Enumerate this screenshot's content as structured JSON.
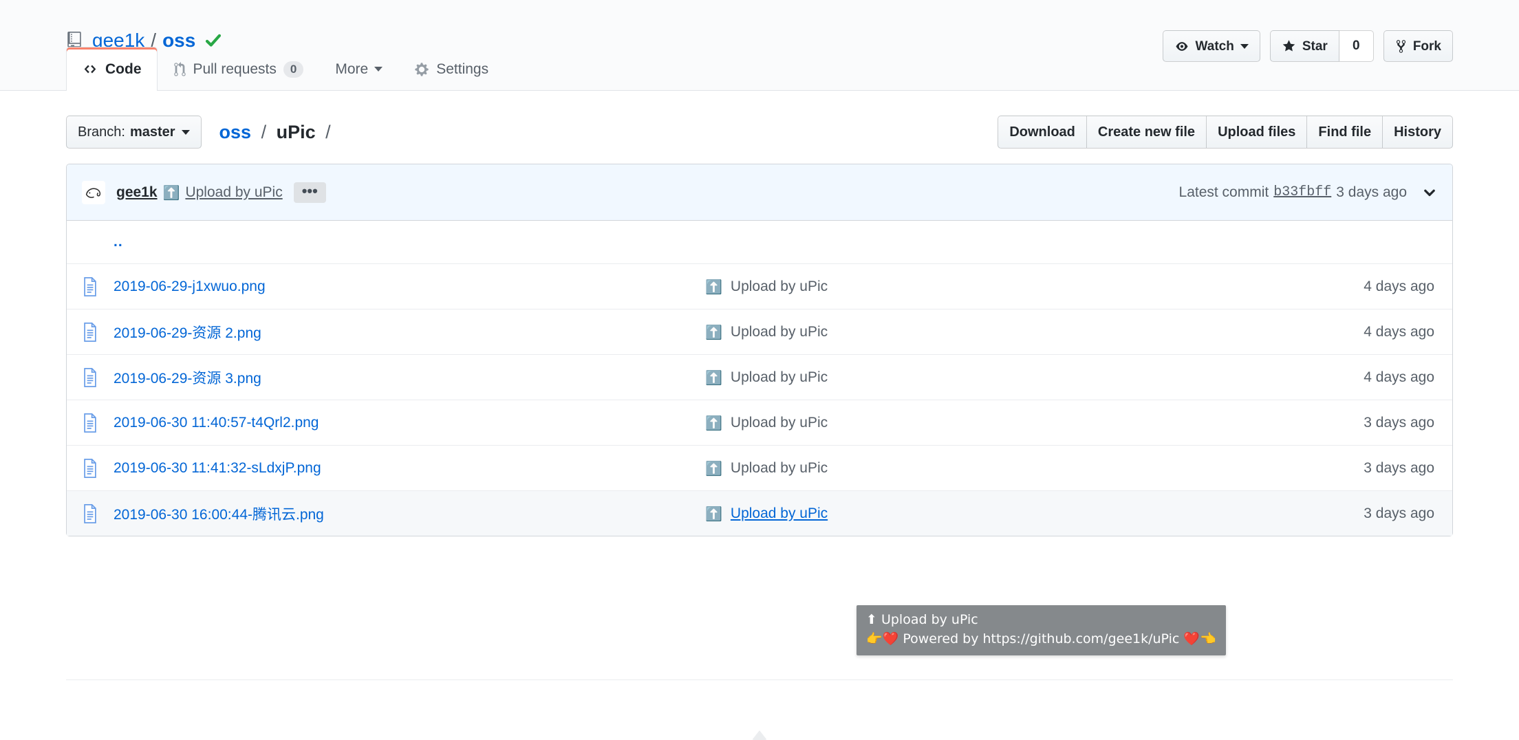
{
  "repo": {
    "icon": "repo-icon",
    "owner": "gee1k",
    "separator": "/",
    "name": "oss",
    "verified_icon": "verified-check-icon"
  },
  "header_actions": {
    "watch": {
      "label": "Watch",
      "icon": "eye-icon"
    },
    "star": {
      "label": "Star",
      "icon": "star-icon",
      "count": "0"
    },
    "fork": {
      "label": "Fork",
      "icon": "fork-icon"
    }
  },
  "tabs": [
    {
      "label": "Code",
      "icon": "code-icon",
      "selected": true
    },
    {
      "label": "Pull requests",
      "icon": "git-pull-request-icon",
      "count": "0",
      "selected": false
    },
    {
      "label": "More",
      "icon": "",
      "caret": true,
      "selected": false
    },
    {
      "label": "Settings",
      "icon": "gear-icon",
      "selected": false
    }
  ],
  "file_nav": {
    "branch_prefix": "Branch:",
    "branch_name": "master",
    "breadcrumb": {
      "root": "oss",
      "sep1": "/",
      "current": "uPic",
      "sep2": "/"
    },
    "actions": [
      "Download",
      "Create new file",
      "Upload files",
      "Find file",
      "History"
    ]
  },
  "commit_bar": {
    "author": "gee1k",
    "message_emoji": "⬆️",
    "message": "Upload by uPic",
    "more_label": "•••",
    "latest_label": "Latest commit",
    "sha": "b33fbff",
    "age": "3 days ago",
    "expand_icon": "chevron-down-icon"
  },
  "file_table": {
    "parent_dir": "..",
    "rows": [
      {
        "icon": "file-icon",
        "name": "2019-06-29-j1xwuo.png",
        "msg_emoji": "⬆️",
        "message": "Upload by uPic",
        "age": "4 days ago",
        "hovered": false
      },
      {
        "icon": "file-icon",
        "name": "2019-06-29-资源 2.png",
        "msg_emoji": "⬆️",
        "message": "Upload by uPic",
        "age": "4 days ago",
        "hovered": false
      },
      {
        "icon": "file-icon",
        "name": "2019-06-29-资源 3.png",
        "msg_emoji": "⬆️",
        "message": "Upload by uPic",
        "age": "4 days ago",
        "hovered": false
      },
      {
        "icon": "file-icon",
        "name": "2019-06-30 11:40:57-t4Qrl2.png",
        "msg_emoji": "⬆️",
        "message": "Upload by uPic",
        "age": "3 days ago",
        "hovered": false
      },
      {
        "icon": "file-icon",
        "name": "2019-06-30 11:41:32-sLdxjP.png",
        "msg_emoji": "⬆️",
        "message": "Upload by uPic",
        "age": "3 days ago",
        "hovered": false
      },
      {
        "icon": "file-icon",
        "name": "2019-06-30 16:00:44-腾讯云.png",
        "msg_emoji": "⬆️",
        "message": "Upload by uPic",
        "age": "3 days ago",
        "hovered": true
      }
    ]
  },
  "tooltip": {
    "line1": "⬆ Upload by uPic",
    "line2": "👉❤️ Powered by https://github.com/gee1k/uPic ❤️👈"
  },
  "colors": {
    "link": "#0366d6",
    "text": "#24292e",
    "muted": "#586069",
    "border": "#d1d5da",
    "commit_bar_bg": "#f1f8ff",
    "active_tab_accent": "#f9826c",
    "verified_green": "#28a745",
    "tooltip_bg": "#85898c"
  }
}
